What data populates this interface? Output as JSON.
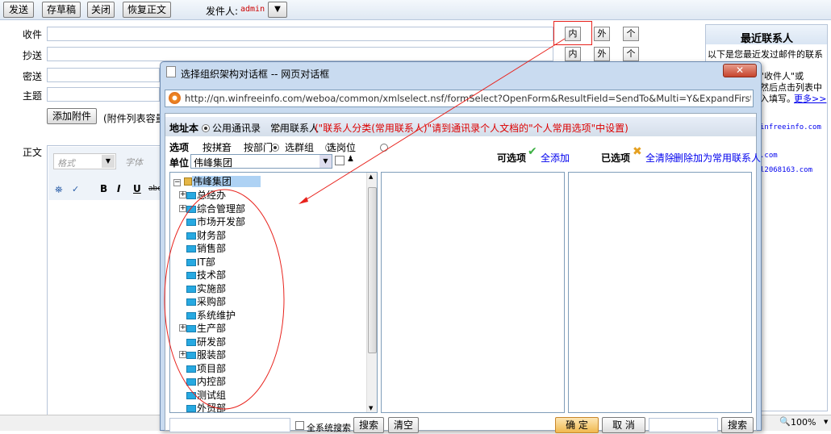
{
  "toolbar": {
    "send": "发送",
    "draft": "存草稿",
    "close": "关闭",
    "restore": "恢复正文",
    "sender_label": "发件人:",
    "sender_name": "admin",
    "dropdown": "▼"
  },
  "form": {
    "to": "收件",
    "cc": "抄送",
    "bcc": "密送",
    "subject": "主题",
    "add_attachment": "添加附件",
    "attach_note": "(附件列表容量不",
    "body": "正文",
    "inner": "内",
    "outer": "外",
    "group": "个"
  },
  "editor": {
    "format": "格式",
    "font": "字体",
    "bold": "B",
    "italic": "I",
    "underline": "U",
    "strike": "abc"
  },
  "contacts": {
    "title": "最近联系人",
    "desc1": "以下是您最近发过邮件的联系",
    "desc2": "\"收件人\"或",
    "desc3": "然后点击列表中",
    "desc4": "入填写。",
    "more": "更多>>",
    "items": [
      "infreeinfo.com",
      ".com",
      "l2068163.com"
    ]
  },
  "dialog": {
    "title": "选择组织架构对话框 -- 网页对话框",
    "url": "http://qn.winfreeinfo.com/weboa/common/xmlselect.nsf/formSelect?OpenForm&ResultField=SendTo&Multi=Y&ExpandFirst=Y&MailType",
    "addressbook_label": "地址本",
    "opt_public": "公用通讯录",
    "opt_common": "常用联系人",
    "note": "(\"联系人分类(常用联系人)\"请到通讯录个人文档的\"个人常用选项\"中设置)",
    "options_label": "选项",
    "opt_pinyin": "按拼音",
    "opt_dept": "按部门",
    "opt_group": "选群组",
    "opt_post": "选岗位",
    "unit_label": "单位",
    "unit_value": "伟峰集团",
    "available_label": "可选项",
    "add_all": "全添加",
    "selected_label": "已选项",
    "clear_all": "全清除",
    "delete": "删除",
    "add_common": "加为常用联系人",
    "search_all_label": "全系统搜索",
    "search": "搜索",
    "clear": "清空",
    "ok": "确 定",
    "cancel": "取 消",
    "search2": "搜索"
  },
  "tree": {
    "root": "伟峰集团",
    "items": [
      {
        "label": "总经办",
        "expandable": true
      },
      {
        "label": "综合管理部",
        "expandable": true
      },
      {
        "label": "市场开发部",
        "expandable": false
      },
      {
        "label": "财务部",
        "expandable": false
      },
      {
        "label": "销售部",
        "expandable": false
      },
      {
        "label": "IT部",
        "expandable": false
      },
      {
        "label": "技术部",
        "expandable": false
      },
      {
        "label": "实施部",
        "expandable": false
      },
      {
        "label": "采购部",
        "expandable": false
      },
      {
        "label": "系统维护",
        "expandable": false
      },
      {
        "label": "生产部",
        "expandable": true
      },
      {
        "label": "研发部",
        "expandable": false
      },
      {
        "label": "服装部",
        "expandable": true
      },
      {
        "label": "项目部",
        "expandable": false
      },
      {
        "label": "内控部",
        "expandable": false
      },
      {
        "label": "测试组",
        "expandable": false
      },
      {
        "label": "外贸部",
        "expandable": false
      }
    ]
  },
  "status": {
    "zoom": "100%"
  },
  "colors": {
    "dialog_title_bg": "#c6d9f0",
    "annotation_red": "#e8221c",
    "accent_blue": "#0000ee"
  }
}
